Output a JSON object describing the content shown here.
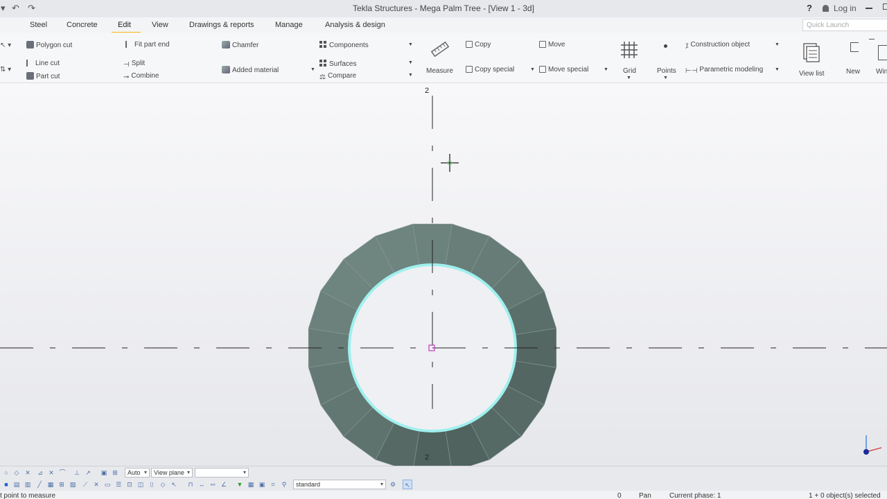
{
  "window": {
    "title": "Tekla Structures - Mega Palm Tree  - [View 1 - 3d]",
    "help": "?",
    "login": "Log in"
  },
  "tabs": [
    "Steel",
    "Concrete",
    "Edit",
    "View",
    "Drawings & reports",
    "Manage",
    "Analysis & design"
  ],
  "active_tab": "Edit",
  "quick_launch": {
    "placeholder": "Quick Launch"
  },
  "ribbon": {
    "polygon_cut": "Polygon cut",
    "line_cut": "Line cut",
    "part_cut": "Part cut",
    "fit_part_end": "Fit part end",
    "split": "Split",
    "combine": "Combine",
    "chamfer": "Chamfer",
    "added_material": "Added material",
    "components": "Components",
    "surfaces": "Surfaces",
    "compare": "Compare",
    "measure": "Measure",
    "copy": "Copy",
    "copy_special": "Copy special",
    "move": "Move",
    "move_special": "Move special",
    "grid": "Grid",
    "points": "Points",
    "construction_object": "Construction object",
    "parametric_modeling": "Parametric modeling",
    "view_list": "View list",
    "new": "New",
    "window": "Win"
  },
  "viewport": {
    "grid_label_top": "2",
    "grid_label_bottom": "2"
  },
  "bottom_toolbar": {
    "snap_mode": "Auto",
    "plane": "View plane",
    "filter": "",
    "selection_filter": "standard"
  },
  "status": {
    "prompt": "t point to measure",
    "count": "0",
    "mode": "Pan",
    "phase": "Current phase: 1",
    "selection": "1 + 0 object(s) selected"
  },
  "colors": {
    "ring_light": "#6f8580",
    "ring_dark": "#4d5f5b",
    "highlight": "#9ff0ee",
    "active_tab_underline": "#f5b50a"
  }
}
